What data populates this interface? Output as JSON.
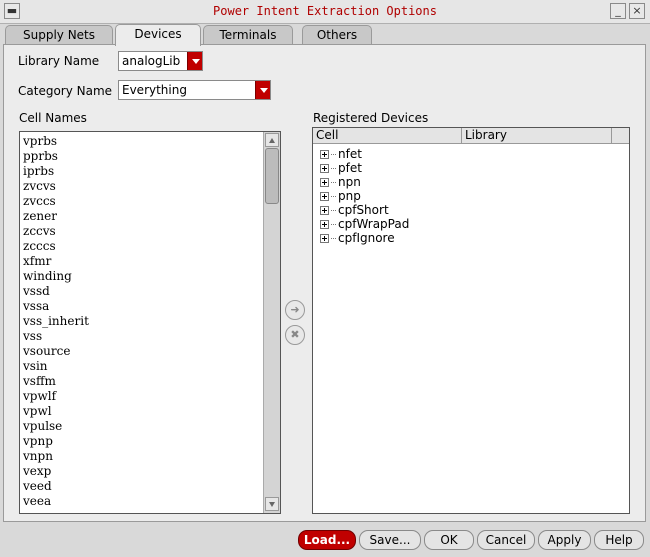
{
  "window": {
    "title": "Power Intent Extraction Options"
  },
  "tabs": [
    {
      "label": "Supply Nets"
    },
    {
      "label": "Devices"
    },
    {
      "label": "Terminals"
    },
    {
      "label": "Others"
    }
  ],
  "active_tab": "Devices",
  "form": {
    "library_label": "Library Name",
    "library_value": "analogLib",
    "category_label": "Category Name",
    "category_value": "Everything",
    "cell_names_label": "Cell Names",
    "registered_label": "Registered Devices"
  },
  "cell_names": [
    "vprbs",
    "pprbs",
    "iprbs",
    "zvcvs",
    "zvccs",
    "zener",
    "zccvs",
    "zcccs",
    "xfmr",
    "winding",
    "vssd",
    "vssa",
    "vss_inherit",
    "vss",
    "vsource",
    "vsin",
    "vsffm",
    "vpwlf",
    "vpwl",
    "vpulse",
    "vpnp",
    "vnpn",
    "vexp",
    "veed",
    "veea"
  ],
  "registered": {
    "columns": [
      "Cell",
      "Library"
    ],
    "items": [
      "nfet",
      "pfet",
      "npn",
      "pnp",
      "cpfShort",
      "cpfWrapPad",
      "cpfIgnore"
    ]
  },
  "buttons": {
    "load": "Load...",
    "save": "Save...",
    "ok": "OK",
    "cancel": "Cancel",
    "apply": "Apply",
    "help": "Help"
  },
  "colors": {
    "accent": "#c00000",
    "title_text": "#b00000"
  }
}
